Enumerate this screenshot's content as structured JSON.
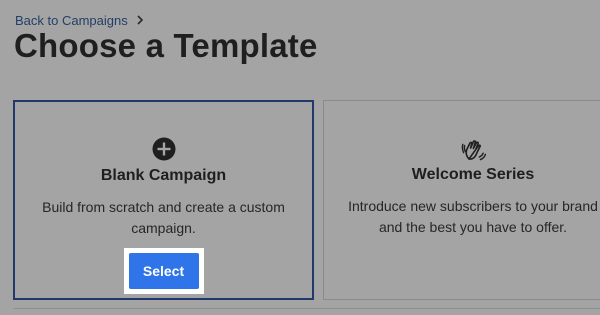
{
  "breadcrumb": {
    "back_label": "Back to Campaigns",
    "separator_icon": "chevron-right-icon"
  },
  "page": {
    "title": "Choose a Template"
  },
  "templates": [
    {
      "icon": "plus-circle-icon",
      "title": "Blank Campaign",
      "description_lines": [
        "Build from scratch and create a custom",
        "campaign."
      ],
      "button_label": "Select",
      "selected": true
    },
    {
      "icon": "waving-hand-icon",
      "title": "Welcome Series",
      "description_lines": [
        "Introduce new subscribers to your brand",
        "and the best you have to offer."
      ]
    }
  ],
  "colors": {
    "overlay_background": "#a4a4a4",
    "link": "#233f68",
    "selected_border": "#23386a",
    "button": "#2f74e8",
    "button_text": "#ffffff"
  }
}
